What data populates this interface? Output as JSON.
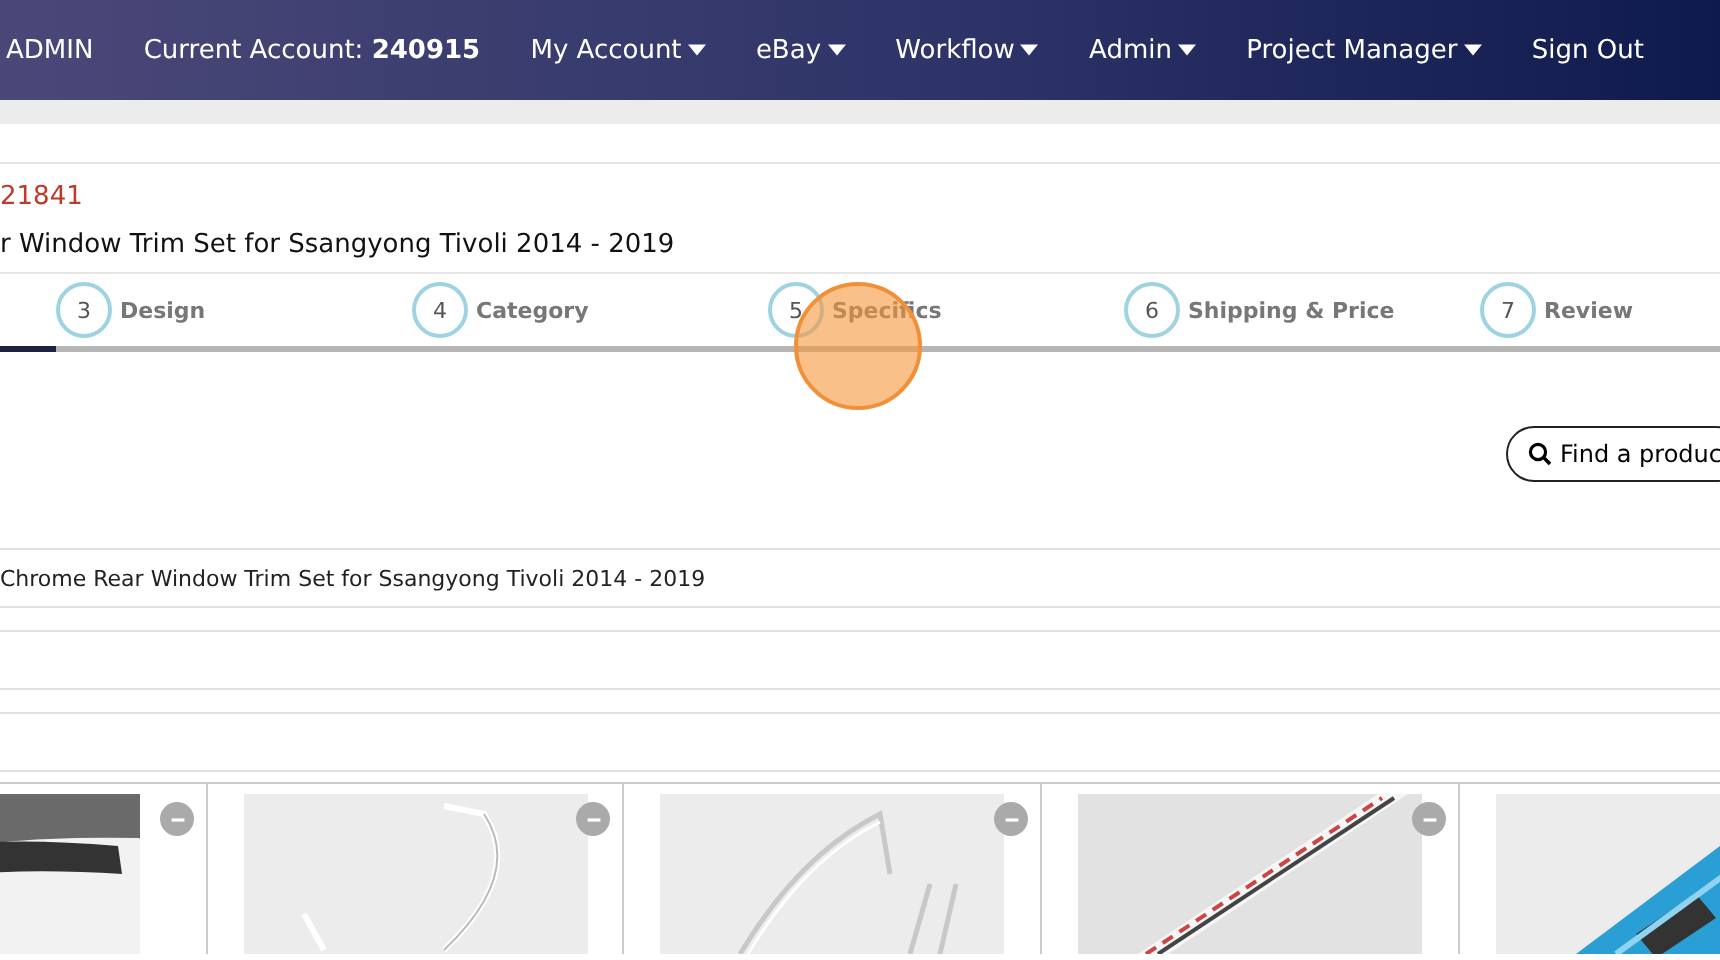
{
  "nav": {
    "items": [
      {
        "label": "ADMIN",
        "kind": "text"
      },
      {
        "label": "Current Account: **240915**",
        "kind": "text"
      },
      {
        "label": "My Account",
        "kind": "menu"
      },
      {
        "label": "eBay",
        "kind": "menu"
      },
      {
        "label": "Workflow",
        "kind": "menu"
      },
      {
        "label": "Admin",
        "kind": "menu"
      },
      {
        "label": "Project Manager",
        "kind": "menu"
      },
      {
        "label": "Sign Out",
        "kind": "link"
      }
    ]
  },
  "listing": {
    "id": "21841",
    "title": "r Window Trim Set for Ssangyong Tivoli 2014 - 2019"
  },
  "steps": [
    {
      "number": "3",
      "label": "Design"
    },
    {
      "number": "4",
      "label": "Category"
    },
    {
      "number": "5",
      "label": "Specifics"
    },
    {
      "number": "6",
      "label": "Shipping & Price"
    },
    {
      "number": "7",
      "label": "Review"
    }
  ],
  "find_button": {
    "label": "Find a produc"
  },
  "rows": [
    {
      "text": "Chrome Rear Window Trim Set for Ssangyong Tivoli 2014 - 2019"
    }
  ],
  "images": [
    {
      "kind": "car"
    },
    {
      "kind": "trim"
    },
    {
      "kind": "trims"
    },
    {
      "kind": "strip"
    },
    {
      "kind": "box"
    }
  ]
}
